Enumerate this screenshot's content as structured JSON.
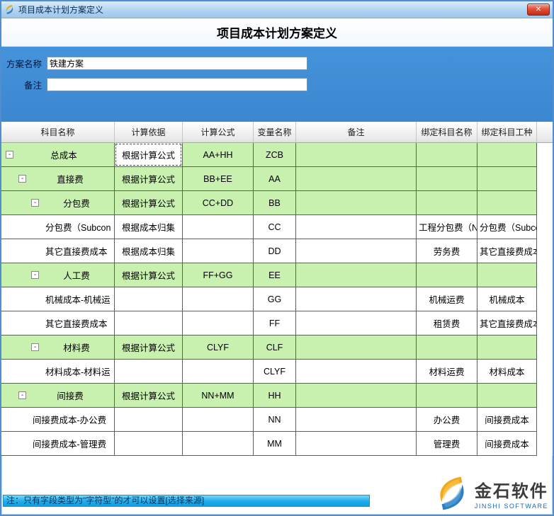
{
  "window": {
    "title": "项目成本计划方案定义"
  },
  "icons": {
    "close": "✕",
    "collapse": "-"
  },
  "header": {
    "title": "项目成本计划方案定义"
  },
  "form": {
    "fields": [
      {
        "label": "方案名称",
        "value": "铁建方案"
      },
      {
        "label": "备注",
        "value": ""
      }
    ]
  },
  "table": {
    "columns": [
      "科目名称",
      "计算依据",
      "计算公式",
      "变量名称",
      "备注",
      "绑定科目名称",
      "绑定科目工种"
    ],
    "rows": [
      {
        "name": "总成本",
        "level": 0,
        "parent": true,
        "green": true,
        "basis": "根据计算公式",
        "formula": "AA+HH",
        "variable": "ZCB",
        "remark": "",
        "bound_name": "",
        "bound_type": "",
        "selected": true
      },
      {
        "name": "直接费",
        "level": 1,
        "parent": true,
        "green": true,
        "basis": "根据计算公式",
        "formula": "BB+EE",
        "variable": "AA",
        "remark": "",
        "bound_name": "",
        "bound_type": ""
      },
      {
        "name": "分包费",
        "level": 2,
        "parent": true,
        "green": true,
        "basis": "根据计算公式",
        "formula": "CC+DD",
        "variable": "BB",
        "remark": "",
        "bound_name": "",
        "bound_type": ""
      },
      {
        "name": "分包费（Subcon",
        "level": 3,
        "parent": false,
        "green": false,
        "basis": "根据成本归集",
        "formula": "",
        "variable": "CC",
        "remark": "",
        "bound_name": "工程分包费（No:",
        "bound_type": "分包费（Subco"
      },
      {
        "name": "其它直接费成本",
        "level": 3,
        "parent": false,
        "green": false,
        "basis": "根据成本归集",
        "formula": "",
        "variable": "DD",
        "remark": "",
        "bound_name": "劳务费",
        "bound_type": "其它直接费成本"
      },
      {
        "name": "人工费",
        "level": 2,
        "parent": true,
        "green": true,
        "basis": "根据计算公式",
        "formula": "FF+GG",
        "variable": "EE",
        "remark": "",
        "bound_name": "",
        "bound_type": ""
      },
      {
        "name": "机械成本-机械运",
        "level": 3,
        "parent": false,
        "green": false,
        "basis": "",
        "formula": "",
        "variable": "GG",
        "remark": "",
        "bound_name": "机械运费",
        "bound_type": "机械成本"
      },
      {
        "name": "其它直接费成本",
        "level": 3,
        "parent": false,
        "green": false,
        "basis": "",
        "formula": "",
        "variable": "FF",
        "remark": "",
        "bound_name": "租赁费",
        "bound_type": "其它直接费成本"
      },
      {
        "name": "材料费",
        "level": 2,
        "parent": true,
        "green": true,
        "basis": "根据计算公式",
        "formula": "CLYF",
        "variable": "CLF",
        "remark": "",
        "bound_name": "",
        "bound_type": ""
      },
      {
        "name": "材料成本-材料运",
        "level": 3,
        "parent": false,
        "green": false,
        "basis": "",
        "formula": "",
        "variable": "CLYF",
        "remark": "",
        "bound_name": "材料运费",
        "bound_type": "材料成本"
      },
      {
        "name": "间接费",
        "level": 1,
        "parent": true,
        "green": true,
        "basis": "根据计算公式",
        "formula": "NN+MM",
        "variable": "HH",
        "remark": "",
        "bound_name": "",
        "bound_type": ""
      },
      {
        "name": "间接费成本-办公费",
        "level": 2,
        "parent": false,
        "green": false,
        "basis": "",
        "formula": "",
        "variable": "NN",
        "remark": "",
        "bound_name": "办公费",
        "bound_type": "间接费成本"
      },
      {
        "name": "间接费成本-管理费",
        "level": 2,
        "parent": false,
        "green": false,
        "basis": "",
        "formula": "",
        "variable": "MM",
        "remark": "",
        "bound_name": "管理费",
        "bound_type": "间接费成本"
      }
    ]
  },
  "statusbar": {
    "text": "注：只有字段类型为\"字符型\"的才可以设置[选择来源]"
  },
  "logo": {
    "cn": "金石软件",
    "en": "JINSHI SOFTWARE"
  },
  "colors": {
    "grid": "#00a000",
    "row-green": "#c8f0ae"
  }
}
